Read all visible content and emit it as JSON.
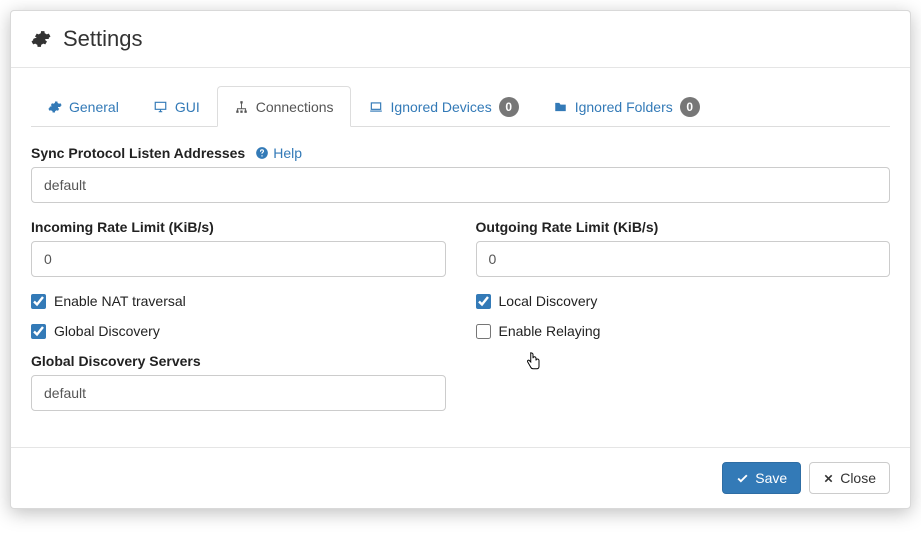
{
  "title": "Settings",
  "tabs": {
    "general": "General",
    "gui": "GUI",
    "connections": "Connections",
    "ignored_devices": "Ignored Devices",
    "ignored_devices_count": "0",
    "ignored_folders": "Ignored Folders",
    "ignored_folders_count": "0"
  },
  "fields": {
    "listen_label": "Sync Protocol Listen Addresses",
    "help": "Help",
    "listen_value": "default",
    "incoming_label": "Incoming Rate Limit (KiB/s)",
    "incoming_value": "0",
    "outgoing_label": "Outgoing Rate Limit (KiB/s)",
    "outgoing_value": "0",
    "nat_label": "Enable NAT traversal",
    "global_disc_label": "Global Discovery",
    "local_disc_label": "Local Discovery",
    "relaying_label": "Enable Relaying",
    "gds_label": "Global Discovery Servers",
    "gds_value": "default"
  },
  "buttons": {
    "save": "Save",
    "close": "Close"
  }
}
